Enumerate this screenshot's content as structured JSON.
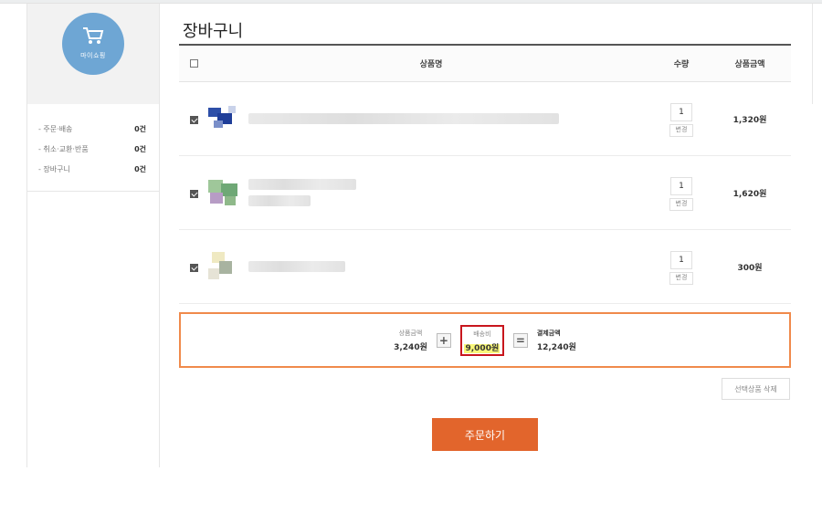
{
  "sidebar": {
    "logo_label": "마이쇼핑",
    "menu": [
      {
        "label": "- 주문·배송",
        "count": "0건"
      },
      {
        "label": "- 취소·교환·반품",
        "count": "0건"
      },
      {
        "label": "- 장바구니",
        "count": "0건"
      }
    ]
  },
  "cart": {
    "title": "장바구니",
    "headers": {
      "name": "상품명",
      "qty": "수량",
      "price": "상품금액"
    },
    "items": [
      {
        "checked": true,
        "qty": "1",
        "change_label": "변경",
        "price": "1,320원"
      },
      {
        "checked": true,
        "qty": "1",
        "change_label": "변경",
        "price": "1,620원"
      },
      {
        "checked": true,
        "qty": "1",
        "change_label": "변경",
        "price": "300원"
      }
    ]
  },
  "summary": {
    "product_label": "상품금액",
    "product_value": "3,240원",
    "plus": "+",
    "shipping_label": "배송비",
    "shipping_value": "9,000원",
    "equals": "=",
    "total_label": "결제금액",
    "total_value": "12,240원"
  },
  "buttons": {
    "delete_selected": "선택상품 삭제",
    "order": "주문하기"
  },
  "colors": {
    "accent": "#e2652c",
    "summary_border": "#f08a4b",
    "highlight_box": "#c8161d",
    "logo": "#6ea6d4"
  }
}
